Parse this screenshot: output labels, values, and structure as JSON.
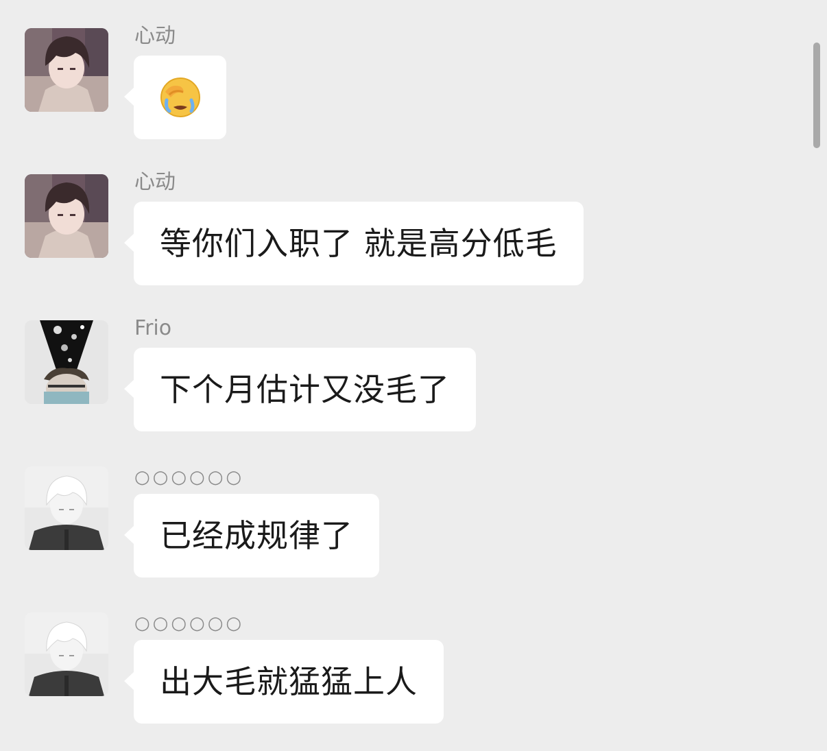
{
  "messages": [
    {
      "sender": "心动",
      "text": "",
      "emoji": "face-palm-crying-emoji",
      "avatar": "avatar-dark-hair-boy"
    },
    {
      "sender": "心动",
      "text": "等你们入职了 就是高分低毛",
      "avatar": "avatar-dark-hair-boy"
    },
    {
      "sender": "Frio",
      "text": "下个月估计又没毛了",
      "avatar": "avatar-space-head"
    },
    {
      "sender": "○○○○○○",
      "text": "已经成规律了",
      "avatar": "avatar-white-hair-boy"
    },
    {
      "sender": "○○○○○○",
      "text": "出大毛就猛猛上人",
      "avatar": "avatar-white-hair-boy"
    }
  ],
  "colors": {
    "background": "#ededed",
    "bubble": "#ffffff",
    "sender_name": "#8a8a8a",
    "message_text": "#1a1a1a"
  }
}
